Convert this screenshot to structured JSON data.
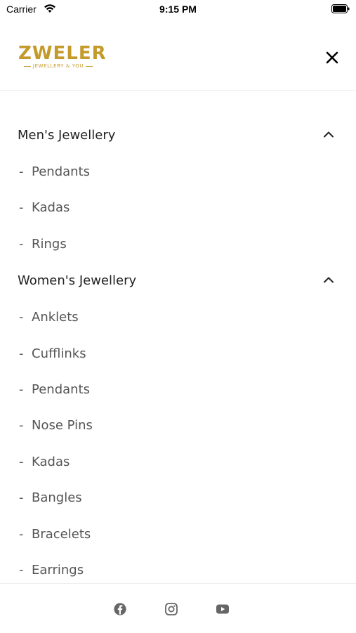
{
  "status_bar": {
    "carrier": "Carrier",
    "time": "9:15 PM"
  },
  "header": {
    "logo_text": "ZWELER",
    "logo_tagline": "JEWELLERY & YOU",
    "brand_color": "#c49a2a"
  },
  "menu": {
    "sections": [
      {
        "title": "Men's Jewellery",
        "expanded": true,
        "items": [
          {
            "label": "Pendants"
          },
          {
            "label": "Kadas"
          },
          {
            "label": "Rings"
          }
        ]
      },
      {
        "title": "Women's Jewellery",
        "expanded": true,
        "items": [
          {
            "label": "Anklets"
          },
          {
            "label": "Cufflinks"
          },
          {
            "label": "Pendants"
          },
          {
            "label": "Nose Pins"
          },
          {
            "label": "Kadas"
          },
          {
            "label": "Bangles"
          },
          {
            "label": "Bracelets"
          },
          {
            "label": "Earrings"
          }
        ]
      }
    ],
    "item_prefix": "-"
  },
  "footer": {
    "icons": [
      "facebook-icon",
      "instagram-icon",
      "youtube-icon"
    ]
  }
}
